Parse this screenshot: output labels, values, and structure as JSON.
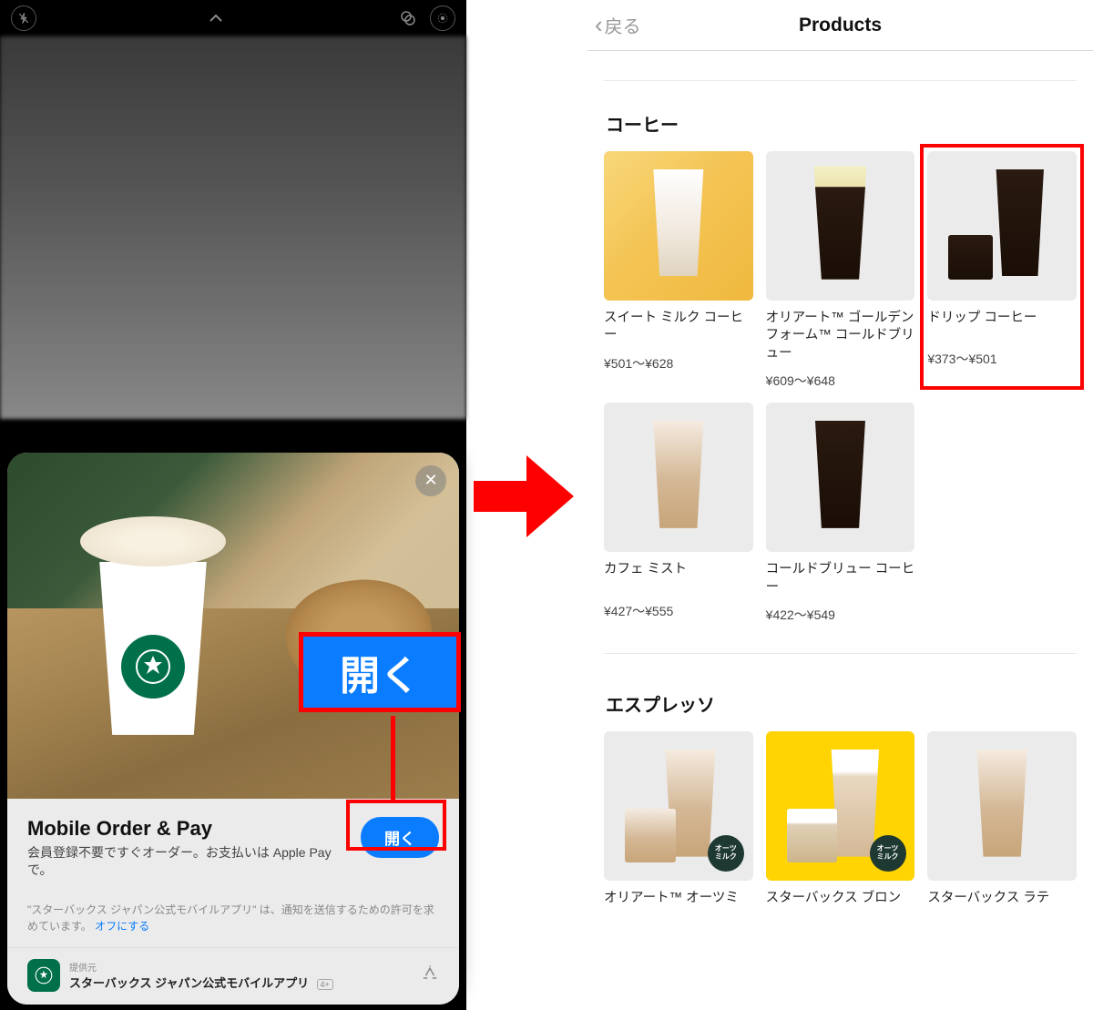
{
  "left": {
    "topbar": {
      "icons": {
        "close": "close-icon",
        "chevron": "chevron-up-icon",
        "stack": "layers-icon",
        "target": "target-icon"
      }
    },
    "appclip": {
      "close_label": "✕",
      "title": "Mobile Order & Pay",
      "description": "会員登録不要ですぐオーダー。お支払いは Apple Pay で。",
      "open_button": "開く",
      "callout_label": "開く",
      "permission_text": "\"スターバックス ジャパン公式モバイルアプリ\" は、通知を送信するための許可を求めています。",
      "permission_link": "オフにする",
      "provider_label": "提供元",
      "provider_name": "スターバックス ジャパン公式モバイルアプリ",
      "provider_age": "4+"
    }
  },
  "right": {
    "back_label": "戻る",
    "page_title": "Products",
    "sections": [
      {
        "title": "コーヒー",
        "products": [
          {
            "name": "スイート ミルク コーヒー",
            "price": "¥501〜¥628",
            "bg": "gold",
            "kind": "milk-tall"
          },
          {
            "name": "オリアート™ ゴールデンフォーム™ コールドブリュー",
            "price": "¥609〜¥648",
            "bg": "grey",
            "kind": "cream-dark"
          },
          {
            "name": "ドリップ コーヒー",
            "price": "¥373〜¥501",
            "bg": "grey",
            "kind": "drip",
            "highlight": true
          },
          {
            "name": "カフェ ミスト",
            "price": "¥427〜¥555",
            "bg": "grey",
            "kind": "latte-tall"
          },
          {
            "name": "コールドブリュー コーヒー",
            "price": "¥422〜¥549",
            "bg": "grey",
            "kind": "dark-tall"
          }
        ]
      },
      {
        "title": "エスプレッソ",
        "products": [
          {
            "name": "オリアート™ オーツミ",
            "price": "",
            "bg": "grey",
            "kind": "latte-combo",
            "oat": true
          },
          {
            "name": "スターバックス ブロン",
            "price": "",
            "bg": "yellow",
            "kind": "dark-combo",
            "oat": true
          },
          {
            "name": "スターバックス ラテ",
            "price": "",
            "bg": "grey",
            "kind": "latte-tall"
          }
        ]
      }
    ],
    "oat_badge_line1": "オーツ",
    "oat_badge_line2": "ミルク"
  }
}
